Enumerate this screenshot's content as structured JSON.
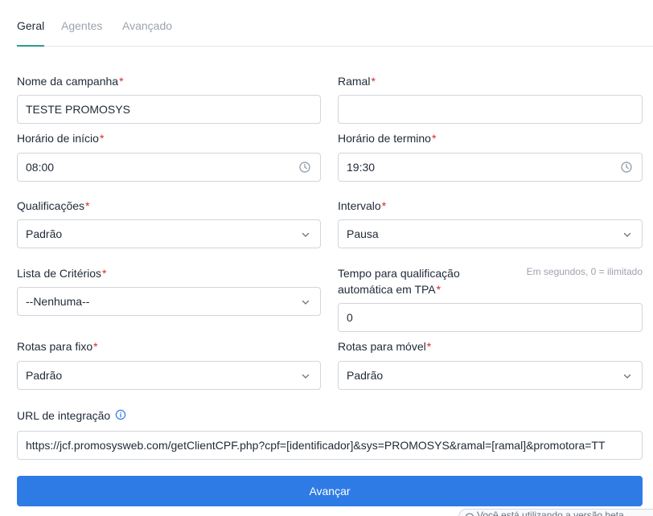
{
  "tabs": [
    {
      "label": "Geral",
      "active": true
    },
    {
      "label": "Agentes",
      "active": false
    },
    {
      "label": "Avançado",
      "active": false
    }
  ],
  "required_marker": "*",
  "form": {
    "nome_campanha": {
      "label": "Nome da campanha",
      "value": "TESTE PROMOSYS"
    },
    "ramal": {
      "label": "Ramal",
      "value": ""
    },
    "horario_inicio": {
      "label": "Horário de início",
      "value": "08:00",
      "icon": "clock-icon"
    },
    "horario_termino": {
      "label": "Horário de termino",
      "value": "19:30",
      "icon": "clock-icon"
    },
    "qualificacoes": {
      "label": "Qualificações",
      "value": "Padrão",
      "icon": "chevron-down-icon"
    },
    "intervalo": {
      "label": "Intervalo",
      "value": "Pausa",
      "icon": "chevron-down-icon"
    },
    "lista_criterios": {
      "label": "Lista de Critérios",
      "value": "--Nenhuma--",
      "icon": "chevron-down-icon"
    },
    "tempo_qualificacao": {
      "label_line1": "Tempo para qualificação",
      "label_line2": "automática em TPA",
      "hint": "Em segundos, 0 = ilimitado",
      "value": "0"
    },
    "rotas_fixo": {
      "label": "Rotas para fixo",
      "value": "Padrão",
      "icon": "chevron-down-icon"
    },
    "rotas_movel": {
      "label": "Rotas para móvel",
      "value": "Padrão",
      "icon": "chevron-down-icon"
    },
    "url_integracao": {
      "label": "URL de integração",
      "icon": "info-icon",
      "value": "https://jcf.promosysweb.com/getClientCPF.php?cpf=[identificador]&sys=PROMOSYS&ramal=[ramal]&promotora=TT"
    }
  },
  "submit_label": "Avançar",
  "version_notice": "Você está utilizando a versão beta",
  "colors": {
    "accent": "#2f7be6",
    "tab_active_underline": "#2f9b8a",
    "required": "#dc2626",
    "border": "#d1d5db"
  }
}
